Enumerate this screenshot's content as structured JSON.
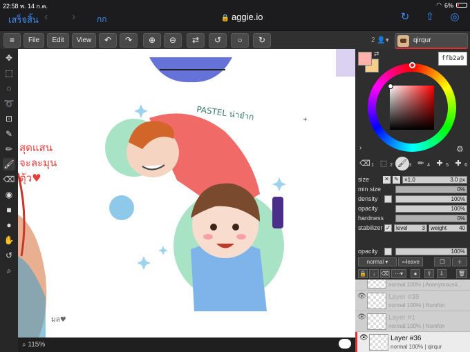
{
  "status_bar": {
    "time": "22:58",
    "date": "พ. 14 ก.ค.",
    "battery": "6%"
  },
  "browser": {
    "done_label": "เสร็จสิ้น",
    "back_icon": "chevron-left-icon",
    "forward_icon": "chevron-right-icon",
    "text_size_label": "กก",
    "url": "aggie.io",
    "icons": [
      "reload-icon",
      "share-icon",
      "compass-icon"
    ]
  },
  "toolbar": {
    "file_label": "File",
    "edit_label": "Edit",
    "view_label": "View",
    "user_count": "2",
    "user_name": "qirqur"
  },
  "left_tools": [
    "move-icon",
    "select-rect-icon",
    "select-ellipse-icon",
    "lasso-icon",
    "transform-icon",
    "eyedropper-icon",
    "pencil-icon",
    "brush-icon",
    "eraser-icon",
    "fill-icon",
    "rectangle-icon",
    "ellipse-icon",
    "hand-icon",
    "undo-icon",
    "zoom-icon"
  ],
  "canvas": {
    "text_left": "สุดแสน\nจะละมุน\nตุ้ว♥",
    "text_pastel": "PASTEL น่ายำก",
    "signature": "มล♥"
  },
  "bottom_bar": {
    "zoom": "115%"
  },
  "color": {
    "primary": "#ffb2a9",
    "secondary": "#f5d08a",
    "hex": "ffb2a9"
  },
  "brushes": [
    {
      "icon": "eraser-icon",
      "num": "1"
    },
    {
      "icon": "select-icon",
      "num": "2"
    },
    {
      "icon": "brush-icon",
      "num": "3"
    },
    {
      "icon": "pencil-icon",
      "num": "4"
    },
    {
      "icon": "plus-icon",
      "num": "5"
    },
    {
      "icon": "plus-icon",
      "num": "6"
    }
  ],
  "props": {
    "size_label": "size",
    "size_mult": "×1.0",
    "size_val": "3.0 px",
    "min_size_label": "min size",
    "min_size_val": "0%",
    "density_label": "density",
    "density_val": "100%",
    "opacity_label": "opacity",
    "opacity_val": "100%",
    "hardness_label": "hardness",
    "hardness_val": "0%",
    "stabilizer_label": "stabilizer",
    "level_label": "level",
    "level_val": "3",
    "weight_label": "weight",
    "weight_val": "40"
  },
  "layer_opacity": {
    "label": "opacity",
    "value": "100%"
  },
  "layer_controls": {
    "blend_mode": "normal",
    "leave_label": "leave"
  },
  "layers": [
    {
      "name": "",
      "meta_mode": "normal 100%",
      "meta_owner": "Anonymous#..."
    },
    {
      "name": "Layer #38",
      "meta_mode": "normal 100%",
      "meta_owner": "Numfon"
    },
    {
      "name": "Layer #1",
      "meta_mode": "normal 100%",
      "meta_owner": "Numfon"
    },
    {
      "name": "Layer #36",
      "meta_mode": "normal 100%",
      "meta_owner": "qirqur"
    }
  ]
}
